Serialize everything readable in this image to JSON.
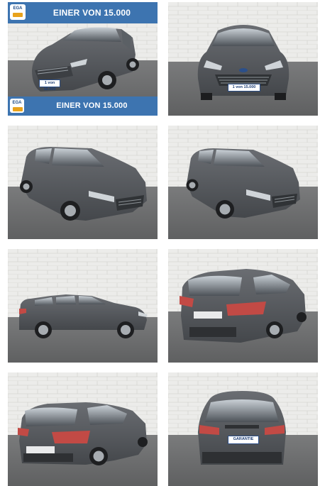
{
  "gallery": {
    "banner_text": "EINER VON 15.000",
    "logo_text": "EGA",
    "plate_1": "1 von 15.000",
    "plate_2": "1 von 15.000",
    "plate_front": "1 von 15.000",
    "plate_rear": "GARANTIE",
    "photos": [
      {
        "view": "front three-quarter",
        "banners": true
      },
      {
        "view": "front"
      },
      {
        "view": "front three-quarter"
      },
      {
        "view": "front three-quarter"
      },
      {
        "view": "side"
      },
      {
        "view": "rear three-quarter"
      },
      {
        "view": "rear three-quarter"
      },
      {
        "view": "rear"
      }
    ]
  },
  "colors": {
    "banner": "#3d74b0",
    "car_body": "#54575c",
    "wall": "#ebebe9",
    "floor": "#6f7071"
  }
}
